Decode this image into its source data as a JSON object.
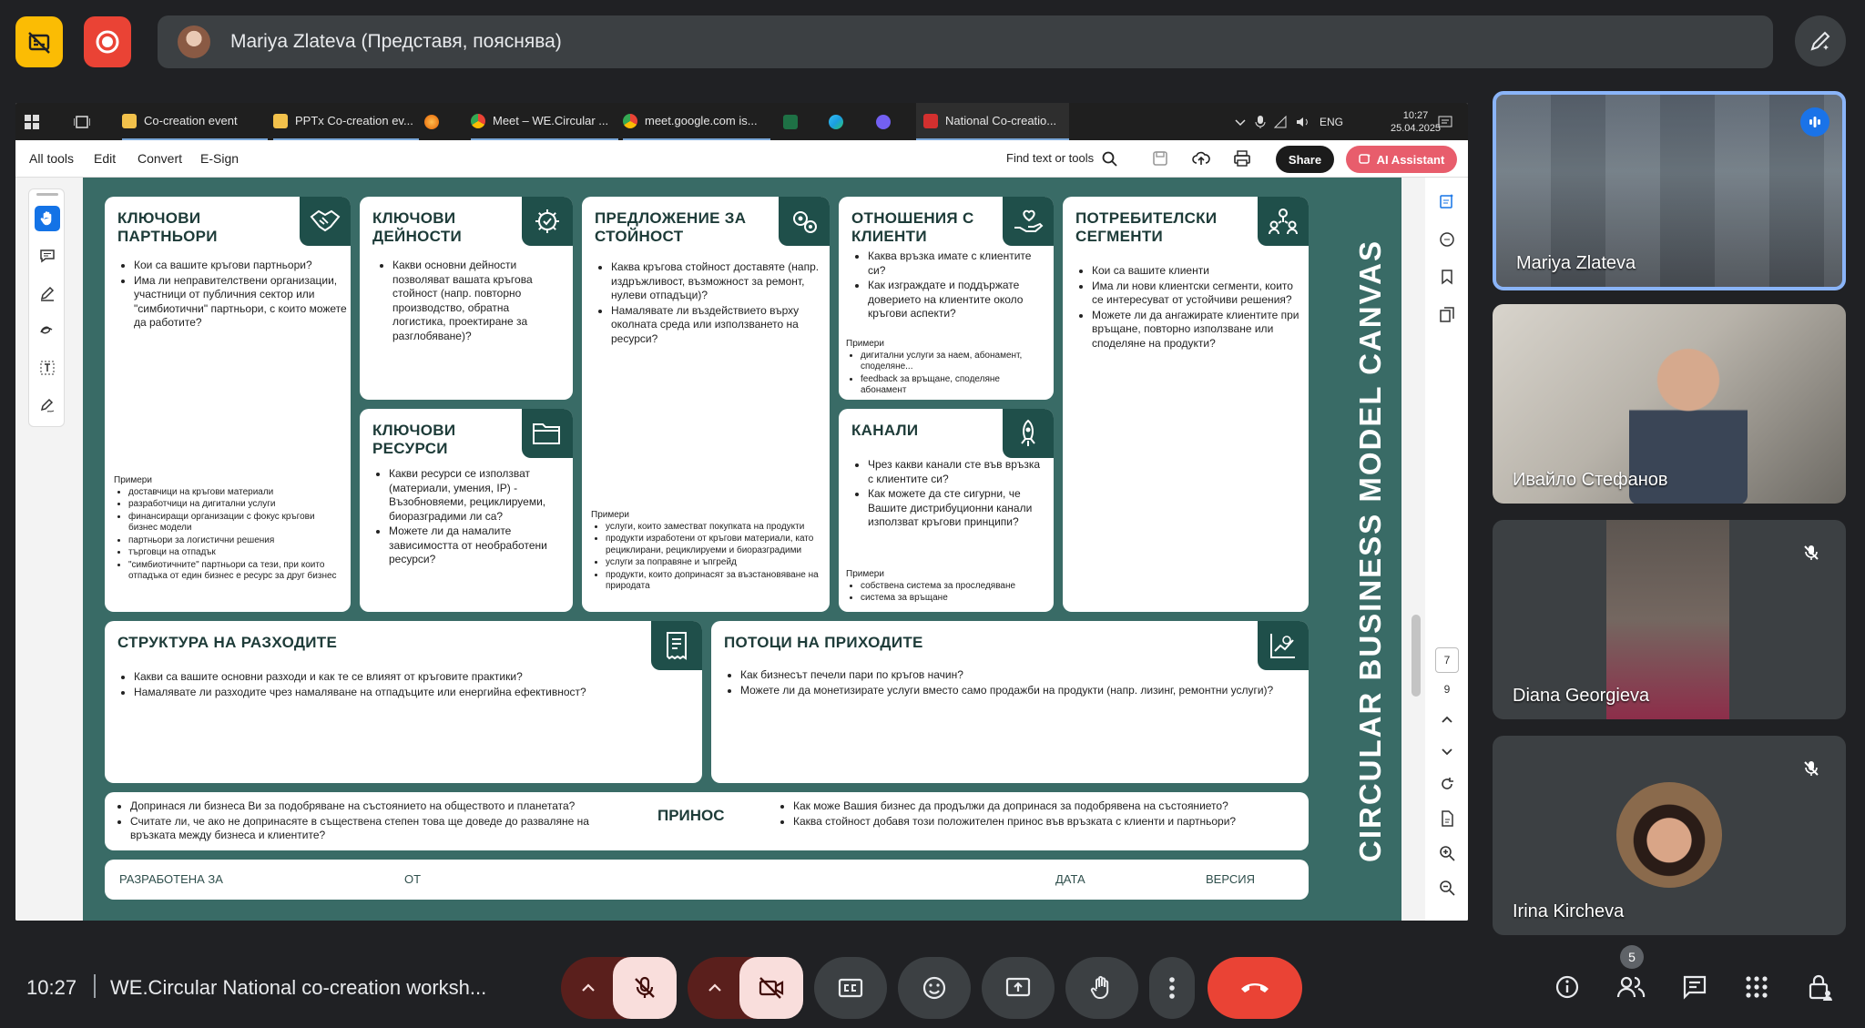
{
  "meet": {
    "presenter_label": "Mariya Zlateva (Представя, пояснява)",
    "time": "10:27",
    "meeting_title": "WE.Circular National co-creation worksh...",
    "participants_count": "5",
    "colors": {
      "record": "#ea4335",
      "captions": "#fbbc04",
      "leave": "#ea4335"
    }
  },
  "taskbar": {
    "items": [
      "Co-creation event",
      "PPTx Co-creation ev...",
      "Meet – WE.Circular ...",
      "meet.google.com is...",
      "National Co-creatio..."
    ],
    "lang": "ENG",
    "clock_time": "10:27",
    "clock_date": "25.04.2025"
  },
  "acrobat": {
    "menu": [
      "All tools",
      "Edit",
      "Convert",
      "E-Sign"
    ],
    "find_label": "Find text or tools",
    "share_label": "Share",
    "ai_label": "AI Assistant",
    "page_current": "7",
    "page_total": "9"
  },
  "canvas": {
    "title": "CIRCULAR BUSINESS MODEL CANVAS",
    "partners": {
      "title": "КЛЮЧОВИ ПАРТНЬОРИ",
      "bullets": [
        "Кои са вашите кръгови партньори?",
        "Има ли неправителствени организации, участници от публичния сектор или \"симбиотични\" партньори, с които можете да работите?"
      ],
      "examples_label": "Примери",
      "examples": [
        "доставчици на кръгови материали",
        "разработчици на дигитални услуги",
        "финансиращи организации с фокус кръгови бизнес модели",
        "партньори за логистични решения",
        "търговци на отпадък",
        "\"симбиотичните\" партньори са тези, при които отпадъка от един бизнес е ресурс за друг бизнес"
      ]
    },
    "activities": {
      "title": "КЛЮЧОВИ ДЕЙНОСТИ",
      "bullets": [
        "Какви основни дейности позволяват вашата кръгова стойност (напр. повторно производство, обратна логистика, проектиране за разглобяване)?"
      ]
    },
    "resources": {
      "title": "КЛЮЧОВИ РЕСУРСИ",
      "bullets": [
        "Какви ресурси се използват (материали, умения, IP) - Възобновяеми, рециклируеми, биоразградими ли са?",
        "Можете ли да намалите зависимостта от необработени ресурси?"
      ]
    },
    "value": {
      "title": "ПРЕДЛОЖЕНИЕ ЗА СТОЙНОСТ",
      "bullets": [
        "Каква кръгова стойност доставяте (напр. издръжливост, възможност за ремонт, нулеви отпадъци)?",
        "Намалявате ли въздействието върху околната среда или използването на ресурси?"
      ],
      "examples_label": "Примери",
      "examples": [
        "услуги, които заместват покупката на продукти",
        "продукти изработени от кръгови материали, като рециклирани, рециклируеми и биоразградими",
        "услуги за поправяне и ъпгрейд",
        "продукти, които допринасят за възстановяване на природата"
      ]
    },
    "relations": {
      "title": "ОТНОШЕНИЯ С КЛИЕНТИ",
      "bullets": [
        "Каква връзка имате с клиентите си?",
        "Как изграждате и поддържате доверието на клиентите около кръгови аспекти?"
      ],
      "examples_label": "Примери",
      "examples": [
        "дигитални услуги за наем, абонамент, споделяне...",
        "feedback за връщане, споделяне абонамент"
      ]
    },
    "channels": {
      "title": "КАНАЛИ",
      "bullets": [
        "Чрез какви канали сте във връзка с клиентите си?",
        "Как можете да сте сигурни, че Вашите дистрибуционни канали използват кръгови принципи?"
      ],
      "examples_label": "Примери",
      "examples": [
        "собствена система за проследяване",
        "система за връщане"
      ]
    },
    "segments": {
      "title": "ПОТРЕБИТЕЛСКИ СЕГМЕНТИ",
      "bullets": [
        "Кои са вашите клиенти",
        "Има ли нови клиентски сегменти, които се интересуват от устойчиви решения?",
        "Можете ли да ангажирате клиентите при връщане, повторно използване или споделяне на продукти?"
      ]
    },
    "costs": {
      "title": "СТРУКТУРА НА РАЗХОДИТЕ",
      "bullets": [
        "Какви са вашите основни разходи и как те се влияят от кръговите практики?",
        "Намалявате ли разходите чрез намаляване на отпадъците или енергийна ефективност?"
      ]
    },
    "revenue": {
      "title": "ПОТОЦИ НА ПРИХОДИТЕ",
      "bullets": [
        "Как бизнесът печели пари по кръгов начин?",
        "Можете ли да монетизирате услуги вместо само продажби на продукти (напр. лизинг, ремонтни услуги)?"
      ]
    },
    "contribution": {
      "title": "ПРИНОС",
      "left": [
        "Допринася ли бизнеса Ви за подобряване на състоянието на обществото и планетата?",
        "Считате ли, че ако не допринасяте в съществена степен това ще доведе до разваляне на връзката между бизнеса и клиентите?"
      ],
      "right": [
        "Как може Вашия бизнес да продължи да допринася за подобрявена на състоянието?",
        "Каква стойност добавя този положителен принос във връзката с клиенти и партньори?"
      ]
    },
    "footer": {
      "designed_for": "РАЗРАБОТЕНА ЗА",
      "by": "ОТ",
      "date": "ДАТА",
      "version": "ВЕРСИЯ"
    }
  },
  "participants": [
    {
      "name": "Mariya Zlateva",
      "speaking": true
    },
    {
      "name": "Ивайло Стефанов",
      "speaking": false
    },
    {
      "name": "Diana Georgieva",
      "muted": true
    },
    {
      "name": "Irina Kircheva",
      "muted": true
    }
  ]
}
